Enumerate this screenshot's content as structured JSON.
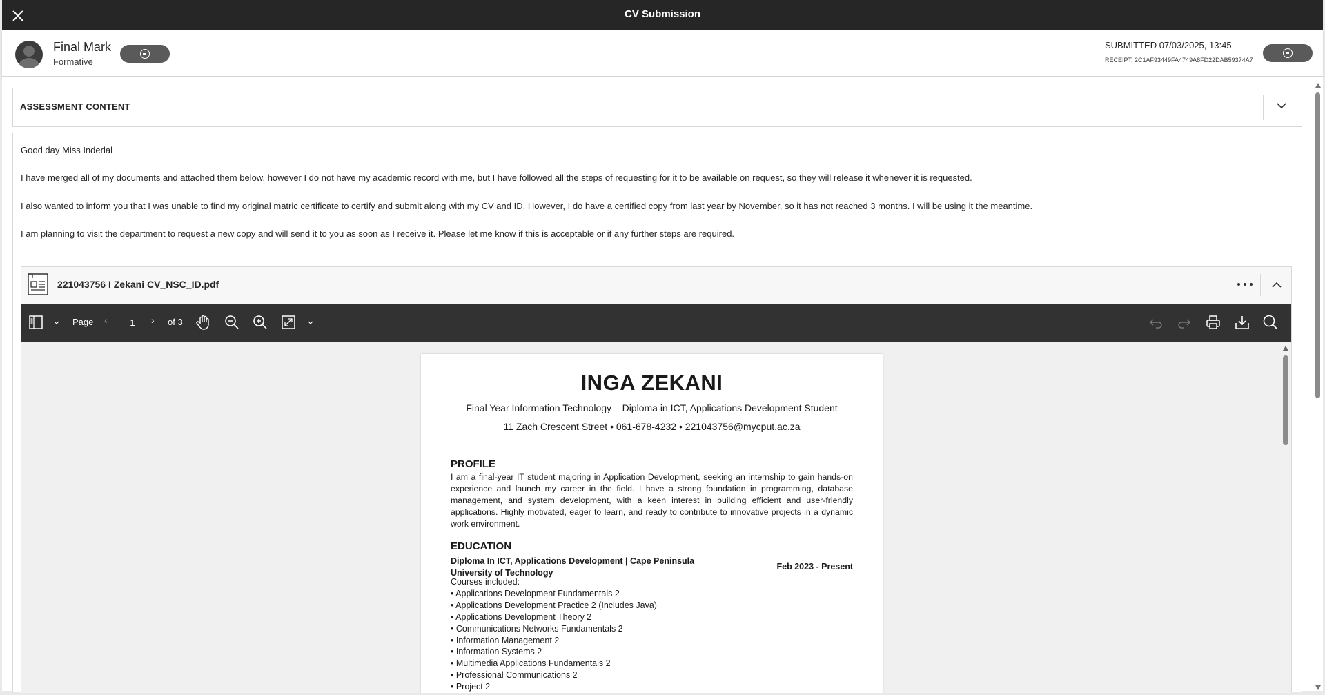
{
  "window": {
    "title": "CV Submission"
  },
  "header": {
    "mark_title": "Final Mark",
    "mark_subtitle": "Formative",
    "submitted": "SUBMITTED 07/03/2025, 13:45",
    "receipt": "RECEIPT: 2C1AF93449FA4749A8FD22DAB59374A7"
  },
  "assessment": {
    "label": "ASSESSMENT CONTENT"
  },
  "message": {
    "lines": [
      "Good day Miss Inderlal",
      "I have merged all of my documents and attached them below, however I do not have my academic record with me, but I have followed all the steps of requesting for it to be available on request, so they will release it whenever it is requested.",
      "I also wanted to inform you that I was unable to find my original matric certificate to certify and submit along with my CV and ID. However, I do have a certified copy from last year by November, so it has not reached 3 months. I will be using it the meantime.",
      "I am planning to visit the department to request a new copy and will send it to you as soon as I receive it. Please let me know if this is acceptable or if any further steps are required."
    ]
  },
  "attachment": {
    "file_name": "221043756 I Zekani CV_NSC_ID.pdf"
  },
  "pdf_toolbar": {
    "page_label": "Page",
    "prev": "‹",
    "current_page": "1",
    "next": "›",
    "of_pages": "of 3"
  },
  "cv": {
    "name": "INGA ZEKANI",
    "subtitle": "Final Year Information Technology – Diploma in ICT, Applications Development Student",
    "contact": "11 Zach Crescent Street • 061-678-4232 • 221043756@mycput.ac.za",
    "profile_heading": "PROFILE",
    "profile_text": "I am a final-year IT student majoring in Application Development, seeking an internship to gain hands-on experience and launch my career in the field. I have a strong foundation in programming, database management, and system development, with a keen interest in building efficient and user-friendly applications. Highly motivated, eager to learn, and ready to contribute to innovative projects in a dynamic work environment.",
    "education_heading": "EDUCATION",
    "degree_line1": "Diploma In ICT, Applications Development | Cape Peninsula",
    "degree_line2": "University of Technology",
    "degree_dates": "Feb 2023 - Present",
    "courses_label": "Courses included:",
    "courses": [
      "• Applications Development Fundamentals 2",
      "• Applications Development Practice 2 (Includes Java)",
      "• Applications Development Theory 2",
      "• Communications Networks Fundamentals 2",
      "• Information Management 2",
      "• Information Systems 2",
      "• Multimedia Applications Fundamentals 2",
      "• Professional Communications 2",
      " • Project 2"
    ]
  }
}
